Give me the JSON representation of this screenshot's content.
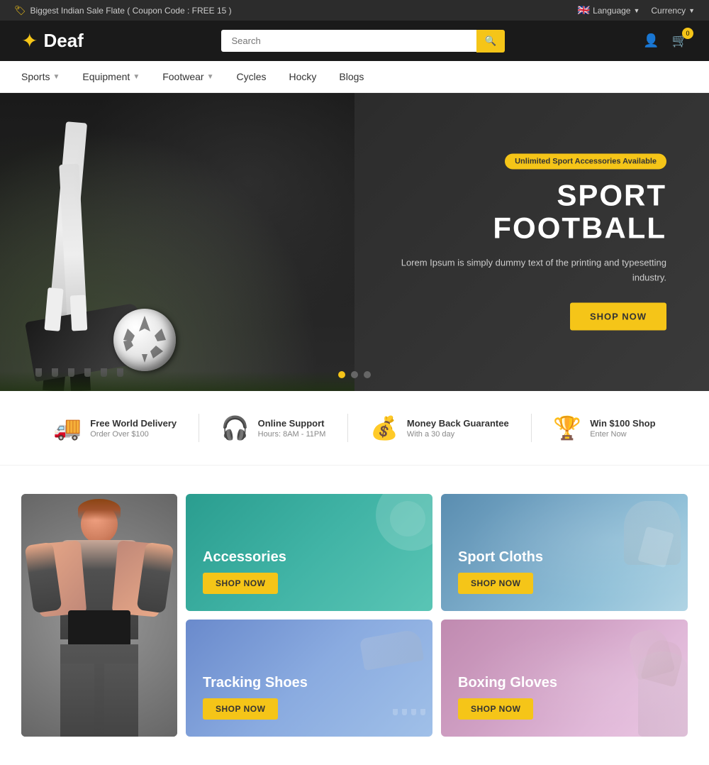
{
  "topbar": {
    "promo": "Biggest Indian Sale Flate ( Coupon Code : FREE 15 )",
    "language": "Language",
    "currency": "Currency"
  },
  "header": {
    "logo_text": "Deaf",
    "search_placeholder": "Search",
    "cart_count": "0"
  },
  "nav": {
    "items": [
      {
        "label": "Sports",
        "has_dropdown": true
      },
      {
        "label": "Equipment",
        "has_dropdown": true
      },
      {
        "label": "Footwear",
        "has_dropdown": true
      },
      {
        "label": "Cycles",
        "has_dropdown": false
      },
      {
        "label": "Hocky",
        "has_dropdown": false
      },
      {
        "label": "Blogs",
        "has_dropdown": false
      }
    ]
  },
  "hero": {
    "badge": "Unlimited Sport Accessories Available",
    "title": "SPORT FOOTBALL",
    "desc": "Lorem Ipsum is simply dummy text of the printing and typesetting industry.",
    "btn_label": "SHOP NOW",
    "dots": [
      {
        "active": true
      },
      {
        "active": false
      },
      {
        "active": false
      }
    ]
  },
  "features": [
    {
      "icon": "🚚",
      "title": "Free World Delivery",
      "subtitle": "Order Over $100"
    },
    {
      "icon": "🎧",
      "title": "Online Support",
      "subtitle": "Hours: 8AM - 11PM"
    },
    {
      "icon": "💰",
      "title": "Money Back Guarantee",
      "subtitle": "With a 30 day"
    },
    {
      "icon": "🏆",
      "title": "Win $100 Shop",
      "subtitle": "Enter Now"
    }
  ],
  "categories": {
    "main_image_alt": "Female athlete",
    "cards": [
      {
        "id": "accessories",
        "title": "Accessories",
        "btn": "SHOP NOW"
      },
      {
        "id": "sport-cloths",
        "title": "Sport Cloths",
        "btn": "SHOP NOW"
      },
      {
        "id": "tracking-shoes",
        "title": "Tracking Shoes",
        "btn": "SHOP NOW"
      },
      {
        "id": "boxing-gloves",
        "title": "Boxing Gloves",
        "btn": "SHOP NOW"
      }
    ]
  }
}
